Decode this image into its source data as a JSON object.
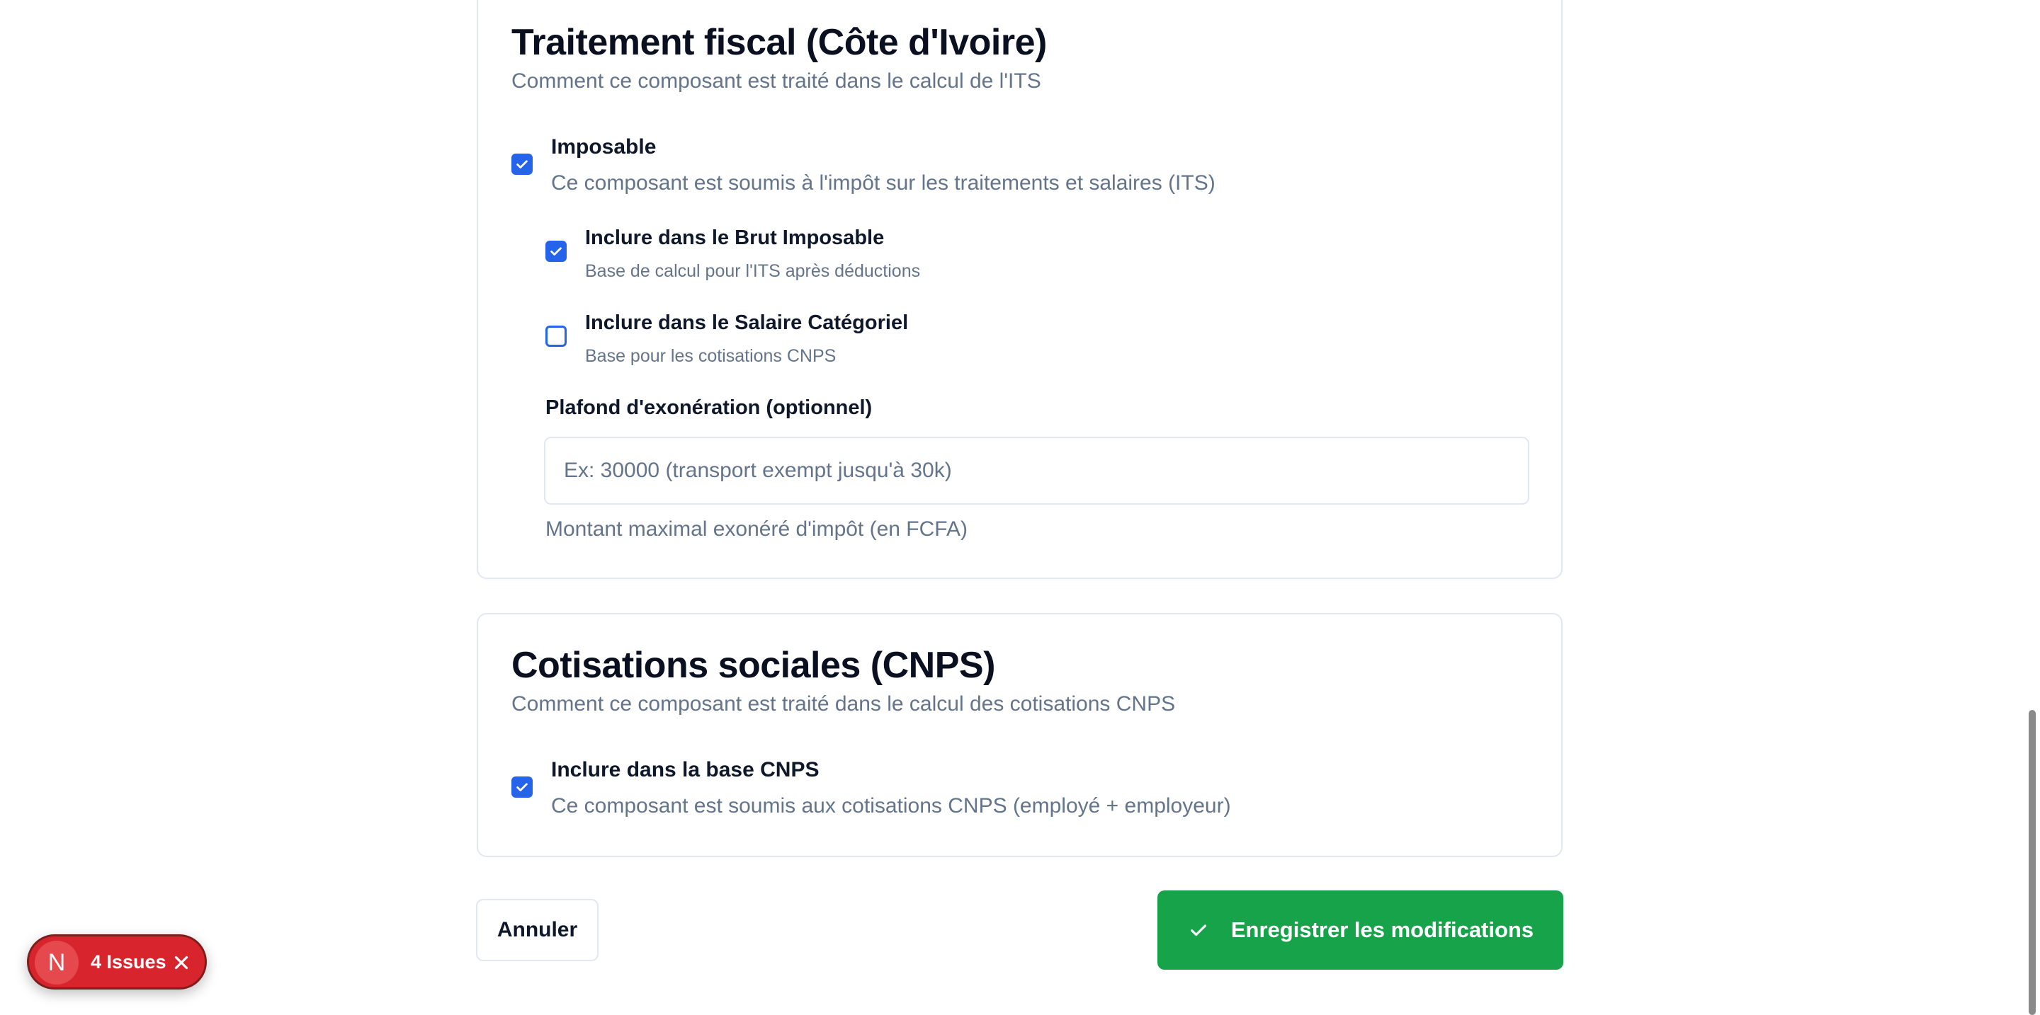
{
  "fiscal": {
    "title": "Traitement fiscal (Côte d'Ivoire)",
    "subtitle": "Comment ce composant est traité dans le calcul de l'ITS",
    "imposable": {
      "label": "Imposable",
      "description": "Ce composant est soumis à l'impôt sur les traitements et salaires (ITS)",
      "checked": true
    },
    "brut_imposable": {
      "label": "Inclure dans le Brut Imposable",
      "description": "Base de calcul pour l'ITS après déductions",
      "checked": true
    },
    "salaire_categoriel": {
      "label": "Inclure dans le Salaire Catégoriel",
      "description": "Base pour les cotisations CNPS",
      "checked": false
    },
    "plafond": {
      "label": "Plafond d'exonération (optionnel)",
      "value": "",
      "placeholder": "Ex: 30000 (transport exempt jusqu'à 30k)",
      "help": "Montant maximal exonéré d'impôt (en FCFA)"
    }
  },
  "cnps": {
    "title": "Cotisations sociales (CNPS)",
    "subtitle": "Comment ce composant est traité dans le calcul des cotisations CNPS",
    "base_cnps": {
      "label": "Inclure dans la base CNPS",
      "description": "Ce composant est soumis aux cotisations CNPS (employé + employeur)",
      "checked": true
    }
  },
  "actions": {
    "cancel_label": "Annuler",
    "save_label": "Enregistrer les modifications"
  },
  "issues_badge": {
    "logo_letter": "N",
    "label": "4 Issues"
  },
  "colors": {
    "accent": "#2563eb",
    "save_button": "#16a34a",
    "issues_badge": "#d8252d",
    "muted_text": "#64748b",
    "border": "#e2e8f0"
  },
  "icons": {
    "checkbox_check": "check-icon",
    "save": "check-icon",
    "dismiss": "close-icon"
  }
}
